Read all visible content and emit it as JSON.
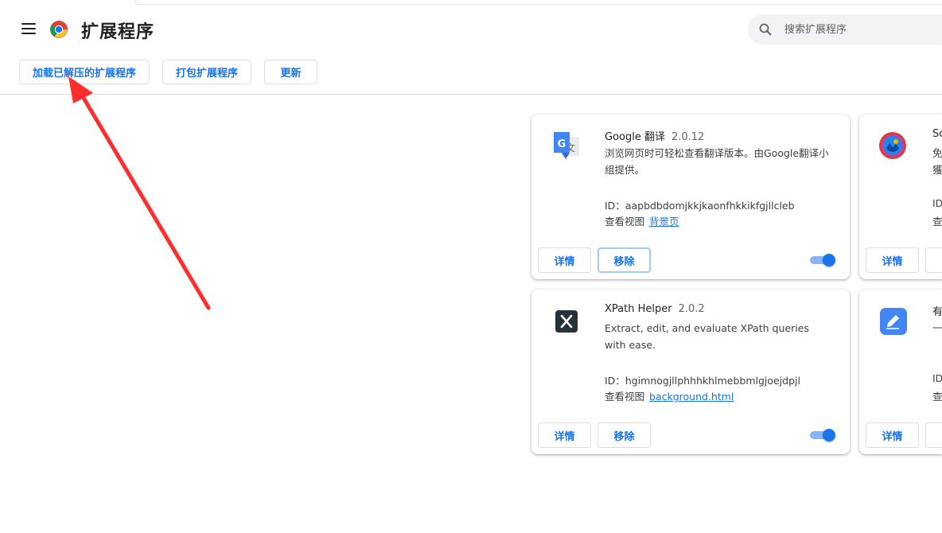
{
  "header": {
    "title": "扩展程序",
    "search_placeholder": "搜索扩展程序"
  },
  "toolbar": {
    "load_unpacked": "加载已解压的扩展程序",
    "pack": "打包扩展程序",
    "update": "更新"
  },
  "cards": [
    {
      "name": "Google 翻译",
      "version": "2.0.12",
      "description": "浏览网页时可轻松查看翻译版本。由Google翻译小组提供。",
      "id_label": "ID：",
      "id": "aapbdbdomjkkjkaonfhkkikfgjllcleb",
      "views_label": "查看视图",
      "view_link": "背景页",
      "details": "详情",
      "remove": "移除",
      "enabled": true,
      "icon": "google-translate-icon"
    },
    {
      "name": "XPath Helper",
      "version": "2.0.2",
      "description": "Extract, edit, and evaluate XPath queries with ease.",
      "id_label": "ID：",
      "id": "hgimnogjllphhhkhlmebbmlgjoejdpjl",
      "views_label": "查看视图",
      "view_link": "background.html",
      "details": "详情",
      "remove": "移除",
      "enabled": true,
      "icon": "xpath-icon"
    },
    {
      "name_fragment": "Sc",
      "desc_line1": "免",
      "desc_line2": "獲",
      "id_fragment": "ID",
      "views_fragment": "查",
      "details": "详情",
      "icon": "colorful-circle-icon"
    },
    {
      "name_fragment": "有",
      "desc_line1": "一",
      "id_fragment": "ID",
      "views_fragment": "查",
      "details": "详情",
      "icon": "blue-pencil-icon"
    }
  ],
  "colors": {
    "accent": "#1a73e8",
    "annotation_arrow": "#ff2d2d"
  }
}
